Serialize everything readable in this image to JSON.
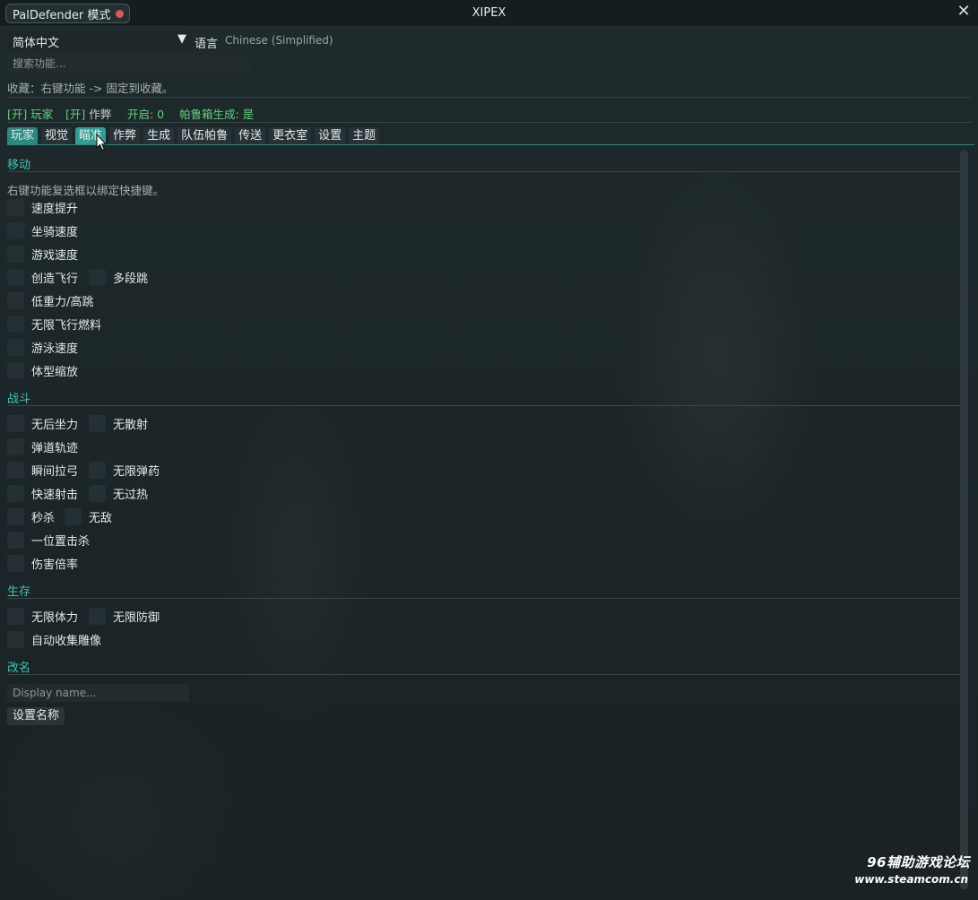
{
  "titlebar": {
    "mode_label": "PalDefender 模式",
    "title": "XIPEX",
    "close_glyph": "✕"
  },
  "language": {
    "selected": "简体中文",
    "arrow": "▼",
    "label": "语言",
    "current": "Chinese (Simplified)"
  },
  "search": {
    "placeholder": "搜索功能..."
  },
  "favorites_hint": "收藏：右键功能 -> 固定到收藏。",
  "status": {
    "player": "[开] 玩家",
    "cheat_prefix": "[开]",
    "cheat_text": "作弊",
    "enabled": "开启: 0",
    "palbox_spawn": "帕鲁箱生成: 是"
  },
  "tabs": [
    "玩家",
    "视觉",
    "瞄准",
    "作弊",
    "生成",
    "队伍帕鲁",
    "传送",
    "更衣室",
    "设置",
    "主题"
  ],
  "sections": {
    "movement": {
      "title": "移动",
      "hint": "右键功能复选框以绑定快捷键。",
      "items": [
        "速度提升",
        "坐骑速度",
        "游戏速度",
        "创造飞行",
        "多段跳",
        "低重力/高跳",
        "无限飞行燃料",
        "游泳速度",
        "体型缩放"
      ]
    },
    "combat": {
      "title": "战斗",
      "items": [
        "无后坐力",
        "无散射",
        "弹道轨迹",
        "瞬间拉弓",
        "无限弹药",
        "快速射击",
        "无过热",
        "秒杀",
        "无敌",
        "一位置击杀",
        "伤害倍率"
      ]
    },
    "survival": {
      "title": "生存",
      "items": [
        "无限体力",
        "无限防御",
        "自动收集雕像"
      ]
    },
    "rename": {
      "title": "改名",
      "placeholder": "Display name...",
      "button": "设置名称"
    }
  },
  "watermark": {
    "line1": "96辅助游戏论坛",
    "line2": "www.steamcom.cn"
  },
  "colors": {
    "accent": "#2b8a80",
    "section_title": "#3fc1b0",
    "status_green": "#5fd27f",
    "record_dot": "#e05555"
  },
  "icons": {
    "record": "red-dot-icon",
    "close": "close-icon",
    "dropdown": "triangle-down-icon",
    "cursor": "mouse-pointer-icon"
  }
}
